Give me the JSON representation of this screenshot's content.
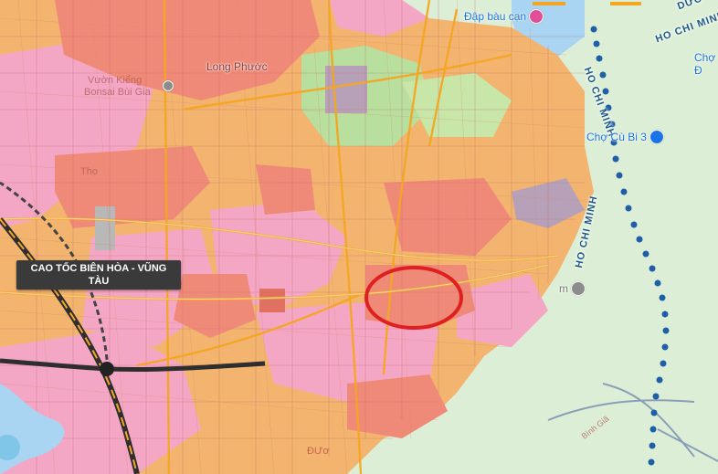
{
  "labels": {
    "road_tag_1": "CAO TỐC BIÊN HÒA - VŨNG",
    "road_tag_2": "TÀU",
    "long_phuoc": "Long Phước",
    "vuon_kieng_1": "Vườn Kiểng",
    "vuon_kieng_2": "Bonsai Bùi Gia",
    "tho": "Thọ",
    "dap_bau": "Đập bàu cạn",
    "cho_cu_bi": "Chợ Cù Bi 3",
    "cho_right_1": "Chợ C",
    "cho_right_2": "Đ",
    "poi_m": "m",
    "binh_gia": "Bình Giã",
    "ho_chi_minh_1": "HO CHI MINH",
    "ho_chi_minh_2": "HO CHI MINH",
    "ho_chi_minh_3": "HO CHI MINH",
    "ho_chi_minh_top": "HO CHI MINH",
    "duong_top": "DƯƠ",
    "duong_bottom": "ĐƯơ"
  },
  "colors": {
    "residential_pink": "#f4a7c4",
    "agri_orange": "#f2b46e",
    "urban_salmon": "#f08a78",
    "forest_green": "#dcefd6",
    "water_blue": "#a9d4f2",
    "highlight_circle": "#e02020",
    "expressway_dark": "#2e2e2e",
    "hcm_route_blue": "#1f5fa8"
  },
  "markers": {
    "highlight": "red-ellipse-circle"
  }
}
